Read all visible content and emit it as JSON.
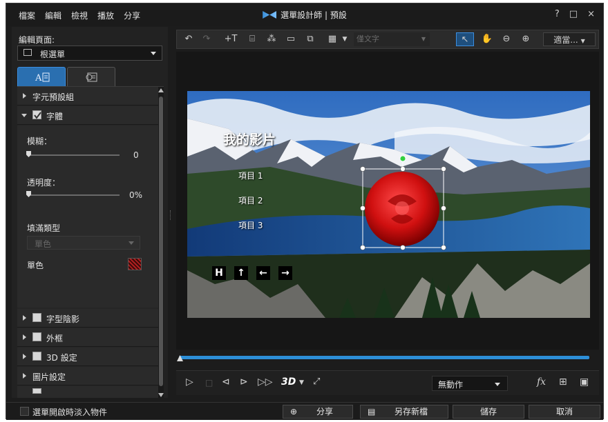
{
  "window": {
    "title": "選單設計師 | 預設",
    "controls": [
      "?",
      "□",
      "×"
    ]
  },
  "menu": [
    "檔案",
    "編輯",
    "檢視",
    "播放",
    "分享"
  ],
  "left": {
    "page_label": "編輯頁面:",
    "page_select": "根選單",
    "sections": [
      {
        "label": "字元預設組",
        "expanded": false,
        "checkbox": false
      },
      {
        "label": "字體",
        "expanded": true,
        "checkbox": true,
        "checked": true
      },
      {
        "label": "字型陰影",
        "expanded": false,
        "checkbox": true,
        "checked": false
      },
      {
        "label": "外框",
        "expanded": false,
        "checkbox": true,
        "checked": false
      },
      {
        "label": "3D 設定",
        "expanded": false,
        "checkbox": true,
        "checked": false
      },
      {
        "label": "圖片設定",
        "expanded": false,
        "checkbox": false
      }
    ],
    "font": {
      "blur_label": "模糊：",
      "blur_value": "0",
      "opacity_label": "透明度：",
      "opacity_value": "0%",
      "fill_type_label": "填滿類型",
      "fill_type_value": "單色",
      "solid_label": "單色"
    },
    "tab_icons": [
      "text-icon",
      "image-icon"
    ]
  },
  "toolbar": {
    "font_placeholder": "僅文字",
    "fit_label": "適當..."
  },
  "scene": {
    "title": "我的影片",
    "items": [
      "項目 1",
      "項目 2",
      "項目 3"
    ],
    "nav_buttons": [
      "H",
      "↑",
      "←",
      "→"
    ]
  },
  "playbar": {
    "mode_3d": "3D",
    "action_select": "無動作",
    "fx": "fx"
  },
  "bottom": {
    "fade_label": "選單開啟時淡入物件",
    "share": "分享",
    "save_as": "另存新檔",
    "save": "儲存",
    "cancel": "取消"
  },
  "colors": {
    "accent": "#2a6fb0",
    "timeline": "#2d8fd8"
  }
}
